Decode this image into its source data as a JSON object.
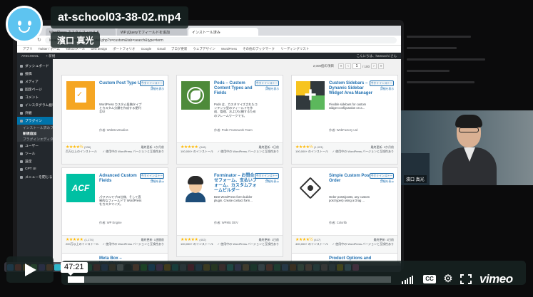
{
  "video": {
    "title": "at-school03-38-02.mp4",
    "byline": "濱口 真光",
    "current_time": "47:21",
    "progress_fraction": 0.05,
    "accent_color": "#5ec4f0"
  },
  "controls": {
    "play_icon": "play-icon",
    "cc_label": "CC",
    "gear_glyph": "⚙",
    "logo": "vimeo"
  },
  "browser": {
    "tabs": [
      "WordPress カスタムフィールド",
      "WP jQueryでフィールドを追加",
      "インストール済み"
    ],
    "url": "localhost/wp-admin/plugin-install.php?s=custom&tab=search&type=term",
    "bookmarks": [
      "アプリ",
      "Twitter / ホーム",
      "Yahoo!メール",
      "web design",
      "ポートフォリオ",
      "Google",
      "Gmail",
      "ブログ更新",
      "ウェブデザイン",
      "WordPress",
      "その他のブックマーク",
      "リーディングリスト"
    ]
  },
  "wp_admin_bar": {
    "site": "ATSCHOOL",
    "new": "+ 新規",
    "user": "こんにちは、hamacchi さん"
  },
  "wp_menu": [
    {
      "label": "ダッシュボード",
      "state": "normal"
    },
    {
      "label": "投稿",
      "state": "normal"
    },
    {
      "label": "メディア",
      "state": "normal"
    },
    {
      "label": "固定ページ",
      "state": "normal"
    },
    {
      "label": "コメント",
      "state": "normal"
    },
    {
      "label": "インスタグラム投稿",
      "state": "normal"
    },
    {
      "label": "外観",
      "state": "normal"
    },
    {
      "label": "プラグイン",
      "state": "current"
    },
    {
      "label": "インストール済みプラグイン",
      "state": "sub"
    },
    {
      "label": "新規追加",
      "state": "sub-current"
    },
    {
      "label": "プラグインエディター",
      "state": "sub"
    },
    {
      "label": "ユーザー",
      "state": "normal"
    },
    {
      "label": "ツール",
      "state": "normal"
    },
    {
      "label": "設定",
      "state": "normal"
    },
    {
      "label": "CPT UI",
      "state": "normal"
    },
    {
      "label": "メニューを閉じる",
      "state": "normal"
    }
  ],
  "pager": {
    "count": "2,000個の項目",
    "first": "«",
    "prev": "‹",
    "current": "1",
    "total": "/ 100",
    "next": "›",
    "last": "»"
  },
  "plugins": [
    {
      "title": "Custom Post Type UI",
      "install": "今すぐインストール",
      "details": "詳細を表示",
      "desc": "WordPress カスタム投稿タイプとカスタム分類を作成する便利なUI",
      "author": "作者: WebDevStudios",
      "stars": "★★★★½",
      "ratings": "(336)",
      "installs": "百万以上のインストール",
      "updated": "最終更新: 1か月前",
      "compat": "✓ 使用中の WordPress バージョンと互換性あり",
      "thumb": "doc-check-icon"
    },
    {
      "title": "Pods – Custom Content Types and Fields",
      "install": "今すぐインストール",
      "details": "詳細を表示",
      "desc": "Pods は、カスタマイズされたコンテンツ型のフィールドを作成、管理、および公開するためのフレームワークです。",
      "author": "作者: Pods Framework Team",
      "stars": "★★★★★",
      "ratings": "(346)",
      "installs": "100,000+ のインストール",
      "updated": "最終更新: 2日前",
      "compat": "✓ 使用中の WordPress バージョンと互換性あり",
      "thumb": "leaf-icon"
    },
    {
      "title": "Custom Sidebars – Dynamic Sidebar Widget Area Manager",
      "install": "今すぐインストール",
      "details": "詳細を表示",
      "desc": "Flexible sidebars for custom widget configuration on a...",
      "author": "作者: WebFactory Ltd",
      "stars": "★★★★½",
      "ratings": "(1,023)",
      "installs": "100,000+ のインストール",
      "updated": "最終更新: 3か月前",
      "compat": "✓ 使用中の WordPress バージョンと互換性あり",
      "thumb": "plus-icon"
    },
    {
      "title": "Advanced Custom Fields",
      "install": "今すぐインストール",
      "details": "詳細を表示",
      "desc": "パワフルでプロ仕様、そして直感的なフィールドで WordPress をカスタマイズ。",
      "author": "作者: WP Engine",
      "stars": "★★★★★",
      "ratings": "(1,174)",
      "installs": "200万以上のインストール",
      "updated": "最終更新: 1週間前",
      "compat": "✓ 使用中の WordPress バージョンと互換性あり",
      "thumb": "acf-logo-icon"
    },
    {
      "title": "Forminator – お問合せフォーム、支払いフォーム、カスタムフォームビルダー",
      "install": "今すぐインストール",
      "details": "詳細を表示",
      "desc": "Best WordPress form builder plugin. Create contact form...",
      "author": "作者: WPMU DEV",
      "stars": "★★★★★",
      "ratings": "(402)",
      "installs": "100,000+ のインストール",
      "updated": "最終更新: 1日前",
      "compat": "✓ 使用中の WordPress バージョンと互換性あり",
      "thumb": "avatar-face-icon"
    },
    {
      "title": "Simple Custom Post Order",
      "install": "今すぐインストール",
      "details": "詳細を表示",
      "desc": "Order posts(posts, any custom post types) using a Drag ...",
      "author": "作者: Colorlib",
      "stars": "★★★★½",
      "ratings": "(417)",
      "installs": "400,000+ のインストール",
      "updated": "最終更新: 3日前",
      "compat": "✓ 使用中の WordPress バージョンと互換性あり",
      "thumb": "hex-node-icon"
    }
  ],
  "peek_cards": [
    "Meta Box – WordPress",
    "Product Options and Price"
  ],
  "webcam": {
    "name": "濱口 真光"
  }
}
